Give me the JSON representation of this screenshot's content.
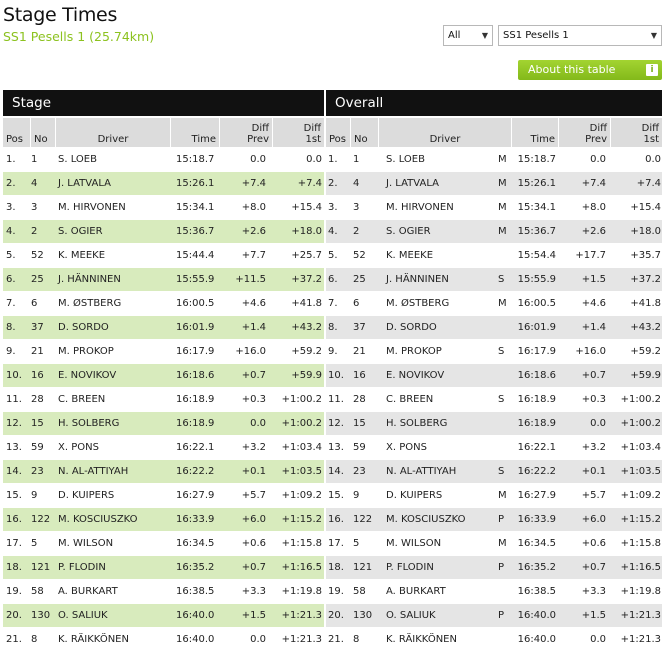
{
  "page": {
    "title": "Stage Times",
    "subtitle": "SS1 Pesells 1 (25.74km)"
  },
  "filters": {
    "class_select": "All",
    "stage_select": "SS1 Pesells 1"
  },
  "about_button": {
    "label": "About this table",
    "icon": "info-icon",
    "icon_glyph": "i"
  },
  "sections": {
    "stage": "Stage",
    "overall": "Overall"
  },
  "columns": {
    "pos": "Pos",
    "no": "No",
    "driver": "Driver",
    "time": "Time",
    "diff_prev_1": "Diff",
    "diff_prev_2": "Prev",
    "diff_first_1": "Diff",
    "diff_first_2": "1st"
  },
  "colors": {
    "accent_green": "#8cc21f",
    "stage_row_alt": "#d8ebbd",
    "overall_row_alt": "#e5e5e5",
    "section_bar": "#111111"
  },
  "stage_rows": [
    {
      "pos": "1.",
      "no": "1",
      "driver": "S. LOEB",
      "time": "15:18.7",
      "diff_prev": "0.0",
      "diff_first": "0.0"
    },
    {
      "pos": "2.",
      "no": "4",
      "driver": "J. LATVALA",
      "time": "15:26.1",
      "diff_prev": "+7.4",
      "diff_first": "+7.4"
    },
    {
      "pos": "3.",
      "no": "3",
      "driver": "M. HIRVONEN",
      "time": "15:34.1",
      "diff_prev": "+8.0",
      "diff_first": "+15.4"
    },
    {
      "pos": "4.",
      "no": "2",
      "driver": "S. OGIER",
      "time": "15:36.7",
      "diff_prev": "+2.6",
      "diff_first": "+18.0"
    },
    {
      "pos": "5.",
      "no": "52",
      "driver": "K. MEEKE",
      "time": "15:44.4",
      "diff_prev": "+7.7",
      "diff_first": "+25.7"
    },
    {
      "pos": "6.",
      "no": "25",
      "driver": "J. HÄNNINEN",
      "time": "15:55.9",
      "diff_prev": "+11.5",
      "diff_first": "+37.2"
    },
    {
      "pos": "7.",
      "no": "6",
      "driver": "M. ØSTBERG",
      "time": "16:00.5",
      "diff_prev": "+4.6",
      "diff_first": "+41.8"
    },
    {
      "pos": "8.",
      "no": "37",
      "driver": "D. SORDO",
      "time": "16:01.9",
      "diff_prev": "+1.4",
      "diff_first": "+43.2"
    },
    {
      "pos": "9.",
      "no": "21",
      "driver": "M. PROKOP",
      "time": "16:17.9",
      "diff_prev": "+16.0",
      "diff_first": "+59.2"
    },
    {
      "pos": "10.",
      "no": "16",
      "driver": "E. NOVIKOV",
      "time": "16:18.6",
      "diff_prev": "+0.7",
      "diff_first": "+59.9"
    },
    {
      "pos": "11.",
      "no": "28",
      "driver": "C. BREEN",
      "time": "16:18.9",
      "diff_prev": "+0.3",
      "diff_first": "+1:00.2"
    },
    {
      "pos": "12.",
      "no": "15",
      "driver": "H. SOLBERG",
      "time": "16:18.9",
      "diff_prev": "0.0",
      "diff_first": "+1:00.2"
    },
    {
      "pos": "13.",
      "no": "59",
      "driver": "X. PONS",
      "time": "16:22.1",
      "diff_prev": "+3.2",
      "diff_first": "+1:03.4"
    },
    {
      "pos": "14.",
      "no": "23",
      "driver": "N. AL-ATTIYAH",
      "time": "16:22.2",
      "diff_prev": "+0.1",
      "diff_first": "+1:03.5"
    },
    {
      "pos": "15.",
      "no": "9",
      "driver": "D. KUIPERS",
      "time": "16:27.9",
      "diff_prev": "+5.7",
      "diff_first": "+1:09.2"
    },
    {
      "pos": "16.",
      "no": "122",
      "driver": "M. KOSCIUSZKO",
      "time": "16:33.9",
      "diff_prev": "+6.0",
      "diff_first": "+1:15.2"
    },
    {
      "pos": "17.",
      "no": "5",
      "driver": "M. WILSON",
      "time": "16:34.5",
      "diff_prev": "+0.6",
      "diff_first": "+1:15.8"
    },
    {
      "pos": "18.",
      "no": "121",
      "driver": "P. FLODIN",
      "time": "16:35.2",
      "diff_prev": "+0.7",
      "diff_first": "+1:16.5"
    },
    {
      "pos": "19.",
      "no": "58",
      "driver": "A. BURKART",
      "time": "16:38.5",
      "diff_prev": "+3.3",
      "diff_first": "+1:19.8"
    },
    {
      "pos": "20.",
      "no": "130",
      "driver": "O. SALIUK",
      "time": "16:40.0",
      "diff_prev": "+1.5",
      "diff_first": "+1:21.3"
    },
    {
      "pos": "21.",
      "no": "8",
      "driver": "K. RÄIKKÖNEN",
      "time": "16:40.0",
      "diff_prev": "0.0",
      "diff_first": "+1:21.3"
    }
  ],
  "overall_rows": [
    {
      "pos": "1.",
      "no": "1",
      "driver": "S. LOEB",
      "cls": "M",
      "time": "15:18.7",
      "diff_prev": "0.0",
      "diff_first": "0.0"
    },
    {
      "pos": "2.",
      "no": "4",
      "driver": "J. LATVALA",
      "cls": "M",
      "time": "15:26.1",
      "diff_prev": "+7.4",
      "diff_first": "+7.4"
    },
    {
      "pos": "3.",
      "no": "3",
      "driver": "M. HIRVONEN",
      "cls": "M",
      "time": "15:34.1",
      "diff_prev": "+8.0",
      "diff_first": "+15.4"
    },
    {
      "pos": "4.",
      "no": "2",
      "driver": "S. OGIER",
      "cls": "M",
      "time": "15:36.7",
      "diff_prev": "+2.6",
      "diff_first": "+18.0"
    },
    {
      "pos": "5.",
      "no": "52",
      "driver": "K. MEEKE",
      "cls": "",
      "time": "15:54.4",
      "diff_prev": "+17.7",
      "diff_first": "+35.7"
    },
    {
      "pos": "6.",
      "no": "25",
      "driver": "J. HÄNNINEN",
      "cls": "S",
      "time": "15:55.9",
      "diff_prev": "+1.5",
      "diff_first": "+37.2"
    },
    {
      "pos": "7.",
      "no": "6",
      "driver": "M. ØSTBERG",
      "cls": "M",
      "time": "16:00.5",
      "diff_prev": "+4.6",
      "diff_first": "+41.8"
    },
    {
      "pos": "8.",
      "no": "37",
      "driver": "D. SORDO",
      "cls": "",
      "time": "16:01.9",
      "diff_prev": "+1.4",
      "diff_first": "+43.2"
    },
    {
      "pos": "9.",
      "no": "21",
      "driver": "M. PROKOP",
      "cls": "S",
      "time": "16:17.9",
      "diff_prev": "+16.0",
      "diff_first": "+59.2"
    },
    {
      "pos": "10.",
      "no": "16",
      "driver": "E. NOVIKOV",
      "cls": "",
      "time": "16:18.6",
      "diff_prev": "+0.7",
      "diff_first": "+59.9"
    },
    {
      "pos": "11.",
      "no": "28",
      "driver": "C. BREEN",
      "cls": "S",
      "time": "16:18.9",
      "diff_prev": "+0.3",
      "diff_first": "+1:00.2"
    },
    {
      "pos": "12.",
      "no": "15",
      "driver": "H. SOLBERG",
      "cls": "",
      "time": "16:18.9",
      "diff_prev": "0.0",
      "diff_first": "+1:00.2"
    },
    {
      "pos": "13.",
      "no": "59",
      "driver": "X. PONS",
      "cls": "",
      "time": "16:22.1",
      "diff_prev": "+3.2",
      "diff_first": "+1:03.4"
    },
    {
      "pos": "14.",
      "no": "23",
      "driver": "N. AL-ATTIYAH",
      "cls": "S",
      "time": "16:22.2",
      "diff_prev": "+0.1",
      "diff_first": "+1:03.5"
    },
    {
      "pos": "15.",
      "no": "9",
      "driver": "D. KUIPERS",
      "cls": "M",
      "time": "16:27.9",
      "diff_prev": "+5.7",
      "diff_first": "+1:09.2"
    },
    {
      "pos": "16.",
      "no": "122",
      "driver": "M. KOSCIUSZKO",
      "cls": "P",
      "time": "16:33.9",
      "diff_prev": "+6.0",
      "diff_first": "+1:15.2"
    },
    {
      "pos": "17.",
      "no": "5",
      "driver": "M. WILSON",
      "cls": "M",
      "time": "16:34.5",
      "diff_prev": "+0.6",
      "diff_first": "+1:15.8"
    },
    {
      "pos": "18.",
      "no": "121",
      "driver": "P. FLODIN",
      "cls": "P",
      "time": "16:35.2",
      "diff_prev": "+0.7",
      "diff_first": "+1:16.5"
    },
    {
      "pos": "19.",
      "no": "58",
      "driver": "A. BURKART",
      "cls": "",
      "time": "16:38.5",
      "diff_prev": "+3.3",
      "diff_first": "+1:19.8"
    },
    {
      "pos": "20.",
      "no": "130",
      "driver": "O. SALIUK",
      "cls": "P",
      "time": "16:40.0",
      "diff_prev": "+1.5",
      "diff_first": "+1:21.3"
    },
    {
      "pos": "21.",
      "no": "8",
      "driver": "K. RÄIKKÖNEN",
      "cls": "",
      "time": "16:40.0",
      "diff_prev": "0.0",
      "diff_first": "+1:21.3"
    }
  ]
}
